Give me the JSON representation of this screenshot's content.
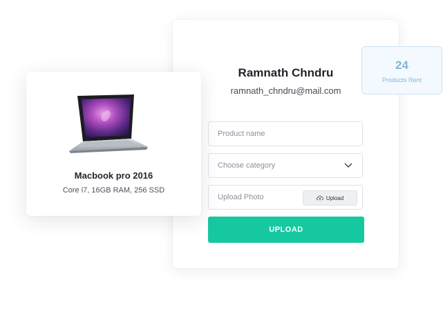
{
  "profile": {
    "name": "Ramnath Chndru",
    "email": "ramnath_chndru@mail.com"
  },
  "form": {
    "product_name_placeholder": "Product name",
    "category_placeholder": "Choose category",
    "photo_placeholder": "Upload Photo",
    "photo_upload_label": "Upload",
    "submit_label": "UPLOAD"
  },
  "stats": {
    "count": "24",
    "label": "Products Rent"
  },
  "product": {
    "title": "Macbook pro 2016",
    "specs": "Core i7, 16GB RAM, 256 SSD"
  },
  "colors": {
    "accent": "#16c8a0",
    "stat_text": "#86b6d8",
    "stat_bg": "#f3f9fe"
  },
  "icons": {
    "category_dropdown": "chevron-down-icon",
    "photo_upload": "cloud-upload-icon",
    "product_image": "laptop-image"
  }
}
